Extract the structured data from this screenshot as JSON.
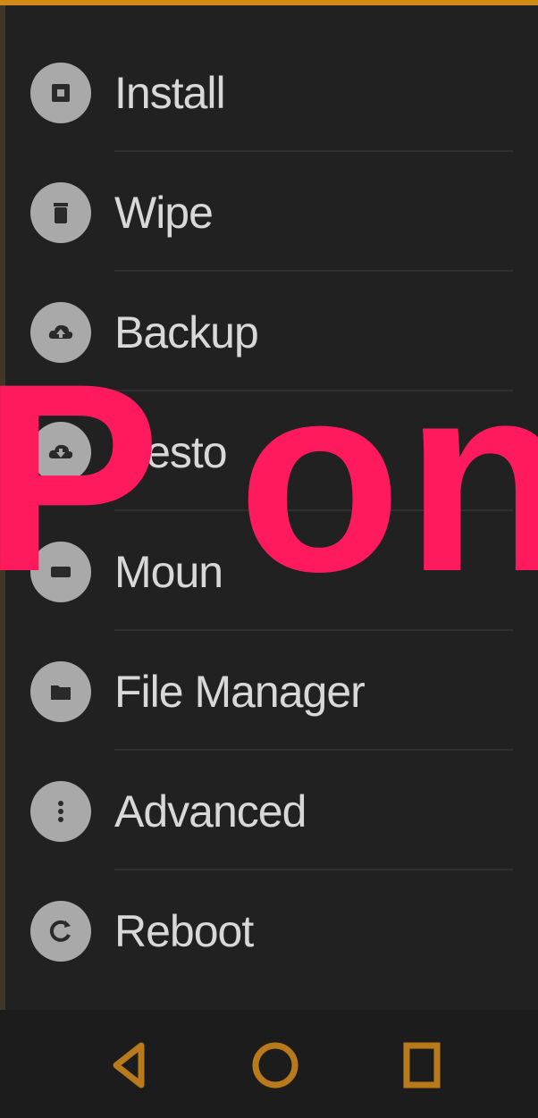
{
  "menu": {
    "items": [
      {
        "label": "Install",
        "icon": "install-icon"
      },
      {
        "label": "Wipe",
        "icon": "trash-icon"
      },
      {
        "label": "Backup",
        "icon": "cloud-up-icon"
      },
      {
        "label": "Resto",
        "icon": "cloud-down-icon"
      },
      {
        "label": "Moun",
        "icon": "drive-icon"
      },
      {
        "label": "File Manager",
        "icon": "folder-icon"
      },
      {
        "label": "Advanced",
        "icon": "more-vert-icon"
      },
      {
        "label": "Reboot",
        "icon": "reboot-icon"
      }
    ]
  },
  "watermark": {
    "text": "P on I"
  },
  "navbar": {
    "back": "back-icon",
    "home": "home-icon",
    "recent": "recent-apps-icon"
  },
  "colors": {
    "accent": "#d08a16",
    "watermark": "#ff1a5e",
    "background": "#212121",
    "icon_circle": "#a9a9a9",
    "label": "#d8d8d8"
  }
}
